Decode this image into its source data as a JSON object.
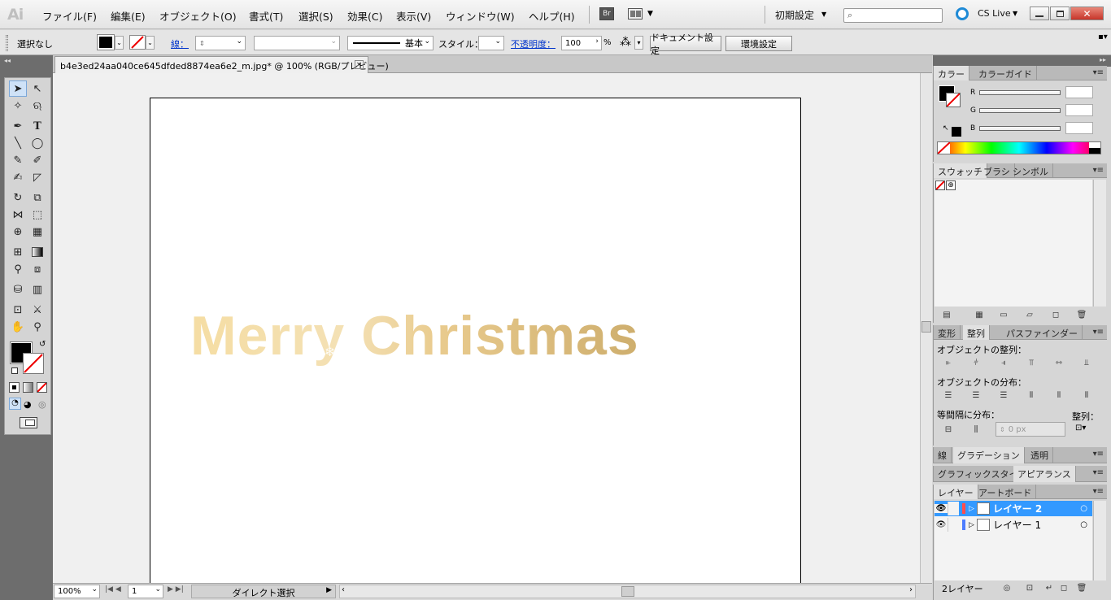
{
  "app": {
    "logo": "Ai",
    "workspace": "初期設定",
    "cs_live": "CS Live",
    "bridge": "Br"
  },
  "menu": [
    "ファイル(F)",
    "編集(E)",
    "オブジェクト(O)",
    "書式(T)",
    "選択(S)",
    "効果(C)",
    "表示(V)",
    "ウィンドウ(W)",
    "ヘルプ(H)"
  ],
  "control": {
    "selection": "選択なし",
    "stroke_label": "線：",
    "stroke_style": "基本",
    "style_label": "スタイル：",
    "opacity_label": "不透明度：",
    "opacity_value": "100",
    "opacity_unit": "%",
    "doc_setup": "ドキュメント設定",
    "prefs": "環境設定"
  },
  "document": {
    "tab_title": "b4e3ed24aa040ce645dfded8874ea6e2_m.jpg* @ 100% (RGB/プレビュー)",
    "artwork_text": "Merry Christmas"
  },
  "status": {
    "zoom": "100%",
    "artboard": "1",
    "tool": "ダイレクト選択"
  },
  "panels": {
    "color": {
      "tabs": [
        "カラー",
        "カラーガイド"
      ],
      "channels": [
        "R",
        "G",
        "B"
      ]
    },
    "swatches": {
      "tabs": [
        "スウォッチ",
        "ブラシ",
        "シンボル"
      ]
    },
    "align": {
      "tabs": [
        "変形",
        "整列",
        "パスファインダー"
      ],
      "align_objects": "オブジェクトの整列：",
      "distribute_objects": "オブジェクトの分布：",
      "distribute_spacing": "等間隔に分布：",
      "spacing_value": "0 px",
      "align_to": "整列："
    },
    "gradient": {
      "tabs": [
        "線",
        "グラデーション",
        "透明"
      ]
    },
    "appearance": {
      "tabs": [
        "グラフィックスタイル",
        "アピアランス"
      ]
    },
    "layers": {
      "tabs": [
        "レイヤー",
        "アートボード"
      ],
      "items": [
        "レイヤー 2",
        "レイヤー 1"
      ],
      "count": "2レイヤー",
      "colors": [
        "#ff4d4d",
        "#4d7dff"
      ]
    }
  },
  "colors": {
    "selection": "#3399ff",
    "gold_light": "#f5dda3",
    "gold_dark": "#ceae6d"
  }
}
